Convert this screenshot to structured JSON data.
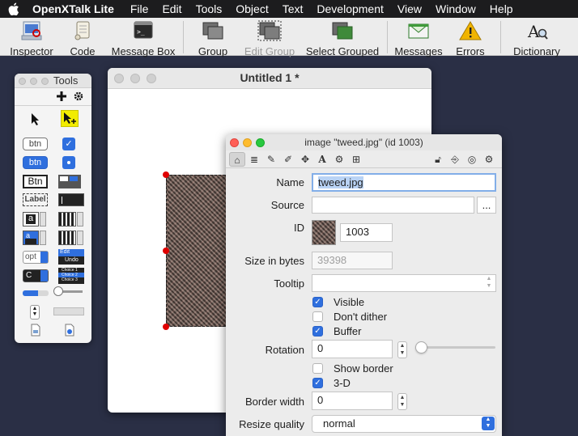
{
  "menubar": {
    "app": "OpenXTalk Lite",
    "items": [
      "File",
      "Edit",
      "Tools",
      "Object",
      "Text",
      "Development",
      "View",
      "Window",
      "Help"
    ]
  },
  "toolbar": {
    "buttons": [
      {
        "label": "Inspector",
        "icon": "inspector-icon"
      },
      {
        "label": "Code",
        "icon": "scroll-icon"
      },
      {
        "label": "Message Box",
        "icon": "terminal-icon"
      },
      {
        "label": "Group",
        "icon": "group-icon"
      },
      {
        "label": "Edit Group",
        "icon": "edit-group-icon"
      },
      {
        "label": "Select Grouped",
        "icon": "select-grouped-icon"
      },
      {
        "label": "Messages",
        "icon": "envelope-icon"
      },
      {
        "label": "Errors",
        "icon": "warning-icon"
      },
      {
        "label": "Dictionary",
        "icon": "dictionary-icon"
      }
    ]
  },
  "tools_palette": {
    "title": "Tools",
    "controls": {
      "btn1": "btn",
      "btn2": "btn",
      "btn3": "Btn",
      "label": "Label",
      "field_a": "a",
      "field_a2": "a",
      "opt": "opt",
      "combo": "C",
      "edit": "Edit",
      "undo": "Undo",
      "choice1": "Choice 1",
      "choice2": "Choice 2",
      "choice3": "Choice 3"
    }
  },
  "stack_window": {
    "title": "Untitled 1 *"
  },
  "inspector": {
    "title": "image \"tweed.jpg\" (id 1003)",
    "name_label": "Name",
    "name_value": "tweed.jpg",
    "source_label": "Source",
    "source_value": "",
    "source_button": "...",
    "id_label": "ID",
    "id_value": "1003",
    "size_label": "Size in bytes",
    "size_value": "39398",
    "tooltip_label": "Tooltip",
    "tooltip_value": "",
    "visible_label": "Visible",
    "visible_checked": true,
    "dither_label": "Don't dither",
    "dither_checked": false,
    "buffer_label": "Buffer",
    "buffer_checked": true,
    "rotation_label": "Rotation",
    "rotation_value": "0",
    "rotation_slider": 0,
    "show_border_label": "Show border",
    "show_border_checked": false,
    "threed_label": "3-D",
    "threed_checked": true,
    "border_width_label": "Border width",
    "border_width_value": "0",
    "resize_label": "Resize quality",
    "resize_value": "normal"
  },
  "colors": {
    "menubar_bg": "#1c1c1e",
    "accent_blue": "#2f6fde",
    "handle_red": "#e00000",
    "desktop": "#2a2f45"
  }
}
